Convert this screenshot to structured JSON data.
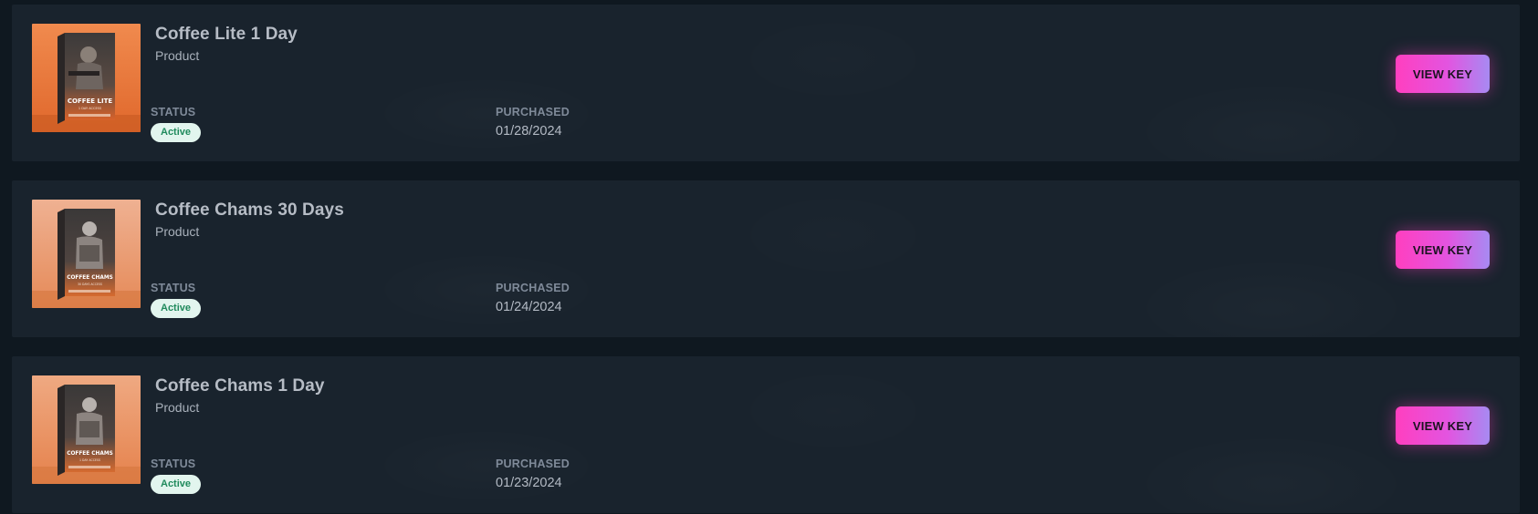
{
  "colors": {
    "page_bg": "#0f1820",
    "card_bg": "#19232d",
    "accent_gradient_start": "#ff3fbf",
    "accent_gradient_end": "#a78af2",
    "badge_bg": "#e2f5ee",
    "badge_text": "#1f8a5c"
  },
  "labels": {
    "status": "STATUS",
    "purchased": "PURCHASED",
    "view_key": "VIEW KEY"
  },
  "products": [
    {
      "title": "Coffee Lite 1 Day",
      "subtitle": "Product",
      "status": "Active",
      "purchased": "01/28/2024",
      "image_icon": "coffee-lite-box-art",
      "box_text": "COFFEE LITE",
      "box_subtext": "1 DAY ACCESS"
    },
    {
      "title": "Coffee Chams 30 Days",
      "subtitle": "Product",
      "status": "Active",
      "purchased": "01/24/2024",
      "image_icon": "coffee-chams-box-art",
      "box_text": "COFFEE CHAMS",
      "box_subtext": "30 DAYS ACCESS"
    },
    {
      "title": "Coffee Chams 1 Day",
      "subtitle": "Product",
      "status": "Active",
      "purchased": "01/23/2024",
      "image_icon": "coffee-chams-box-art",
      "box_text": "COFFEE CHAMS",
      "box_subtext": "1 DAY ACCESS"
    }
  ]
}
